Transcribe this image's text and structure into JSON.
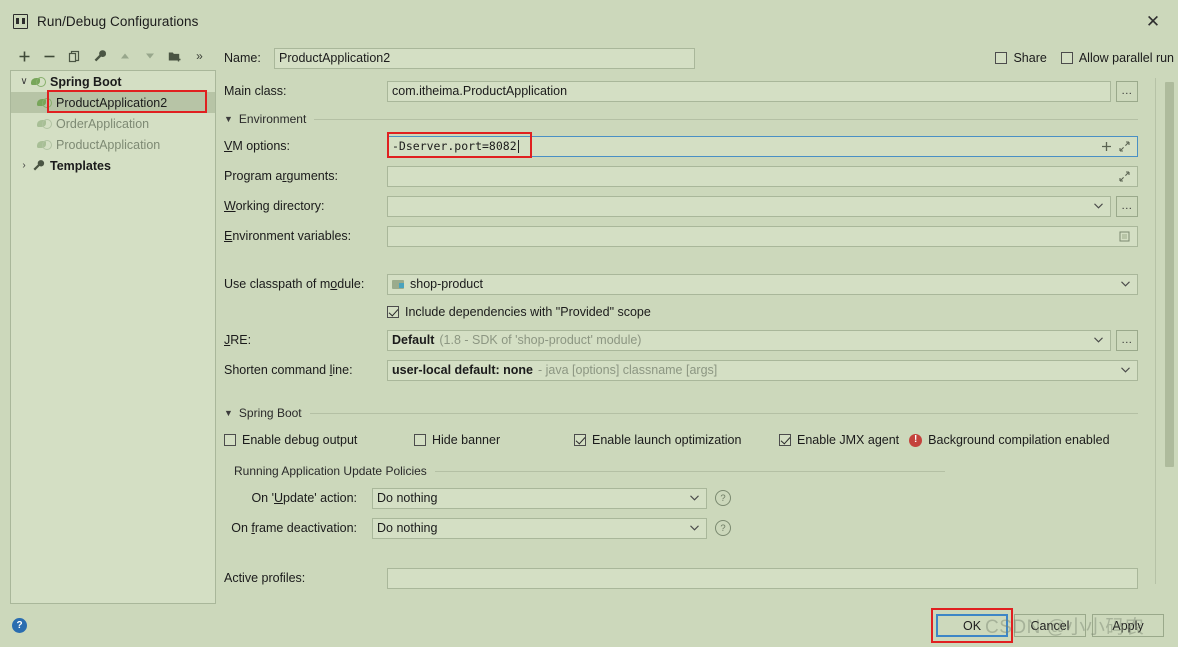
{
  "window": {
    "title": "Run/Debug Configurations",
    "icon": "idea-run-config-icon",
    "close_label": "✕"
  },
  "toolbar": {
    "add_label": "+",
    "remove_label": "−",
    "copy_label": "copy-icon",
    "edit_templates_label": "wrench-icon",
    "move_up_label": "▲",
    "move_down_label": "▼",
    "new_folder_label": "folder-add-icon",
    "more_label": "»"
  },
  "tree": {
    "nodes": [
      {
        "label": "Spring Boot",
        "twisty": "∨",
        "style": "bold",
        "icon": "spring-boot-icon",
        "selected": false,
        "indent": 0
      },
      {
        "label": "ProductApplication2",
        "twisty": "",
        "style": "normal",
        "icon": "spring-boot-icon",
        "selected": true,
        "indent": 1
      },
      {
        "label": "OrderApplication",
        "twisty": "",
        "style": "dim",
        "icon": "spring-boot-icon-dim",
        "selected": false,
        "indent": 1
      },
      {
        "label": "ProductApplication",
        "twisty": "",
        "style": "dim",
        "icon": "spring-boot-icon-dim",
        "selected": false,
        "indent": 1
      },
      {
        "label": "Templates",
        "twisty": "›",
        "style": "bold",
        "icon": "wrench-icon",
        "selected": false,
        "indent": 0
      }
    ]
  },
  "header": {
    "name_label": "Name:",
    "name_value": "ProductApplication2",
    "share_label": "Share",
    "share_checked": false,
    "parallel_label": "Allow parallel run",
    "parallel_checked": false
  },
  "form": {
    "main_class_label": "Main class:",
    "main_class_value": "com.itheima.ProductApplication",
    "main_class_browse": "...",
    "environment_caption": "Environment",
    "vm_options_label": "VM options:",
    "vm_options_value": "-Dserver.port=8082",
    "vm_options_add_icon": "plus-icon",
    "vm_options_expand_icon": "expand-icon",
    "program_args_label": "Program arguments:",
    "program_args_value": "",
    "program_args_expand_icon": "expand-icon",
    "working_dir_label": "Working directory:",
    "working_dir_value": "",
    "working_dir_browse": "...",
    "env_vars_label": "Environment variables:",
    "env_vars_value": "",
    "env_vars_edit_icon": "edit-table-icon",
    "classpath_label": "Use classpath of module:",
    "classpath_value": "shop-product",
    "include_provided_label": "Include dependencies with \"Provided\" scope",
    "include_provided_checked": true,
    "jre_label": "JRE:",
    "jre_value": "Default",
    "jre_value_hint": "(1.8 - SDK of 'shop-product' module)",
    "jre_browse": "...",
    "shorten_label": "Shorten command line:",
    "shorten_value": "user-local default: none",
    "shorten_hint": "- java [options] classname [args]"
  },
  "spring_boot": {
    "caption": "Spring Boot",
    "checkboxes": [
      {
        "label": "Enable debug output",
        "checked": false
      },
      {
        "label": "Hide banner",
        "checked": false
      },
      {
        "label": "Enable launch optimization",
        "checked": true
      },
      {
        "label": "Enable JMX agent",
        "checked": true
      }
    ],
    "warning_icon": "error-icon",
    "warning_text": "Background compilation enabled",
    "policies_caption": "Running Application Update Policies",
    "update_action_label": "On 'Update' action:",
    "update_action_value": "Do nothing",
    "frame_deactivation_label": "On frame deactivation:",
    "frame_deactivation_value": "Do nothing",
    "help_icon": "question-icon",
    "active_profiles_label": "Active profiles:",
    "active_profiles_value": ""
  },
  "footer": {
    "help_icon": "help-icon",
    "ok_label": "OK",
    "cancel_label": "Cancel",
    "apply_label": "Apply",
    "watermark": "CSDN @小小码农"
  },
  "colors": {
    "background": "#ccd8bb",
    "field": "#d4dfc4",
    "border": "#a9b79a",
    "highlight_red": "#e02020",
    "focus_blue": "#4a90c4",
    "error_red": "#c4423c",
    "help_blue": "#2a6db0"
  }
}
